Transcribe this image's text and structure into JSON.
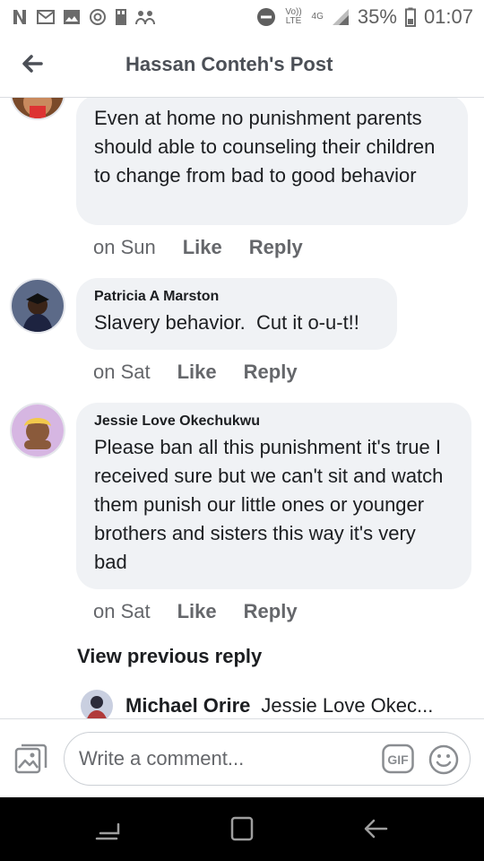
{
  "status_bar": {
    "volte_label": "Vo)) LTE",
    "network_label": "4G",
    "battery_percent": "35%",
    "time": "01:07"
  },
  "header": {
    "title": "Hassan Conteh's Post"
  },
  "comments": [
    {
      "author": "",
      "text": "Even at home no punishment parents should able to counseling their children to change from bad to good behavior",
      "time": "on Sun",
      "like_label": "Like",
      "reply_label": "Reply"
    },
    {
      "author": "Patricia A Marston",
      "text": "Slavery behavior.  Cut it o-u-t!!",
      "time": "on Sat",
      "like_label": "Like",
      "reply_label": "Reply"
    },
    {
      "author": "Jessie Love Okechukwu",
      "text": "Please ban all this punishment it's true I received sure but we can't sit and watch them punish our little ones or younger brothers and sisters this way it's very bad",
      "time": "on Sat",
      "like_label": "Like",
      "reply_label": "Reply"
    }
  ],
  "view_previous_label": "View previous reply",
  "reply_preview": {
    "author": "Michael Orire",
    "snippet": "Jessie Love Okec..."
  },
  "composer": {
    "placeholder": "Write a comment...",
    "gif_label": "GIF"
  },
  "colors": {
    "bubble": "#f0f2f5",
    "meta_text": "#65676b",
    "header_text": "#4b4f56"
  }
}
